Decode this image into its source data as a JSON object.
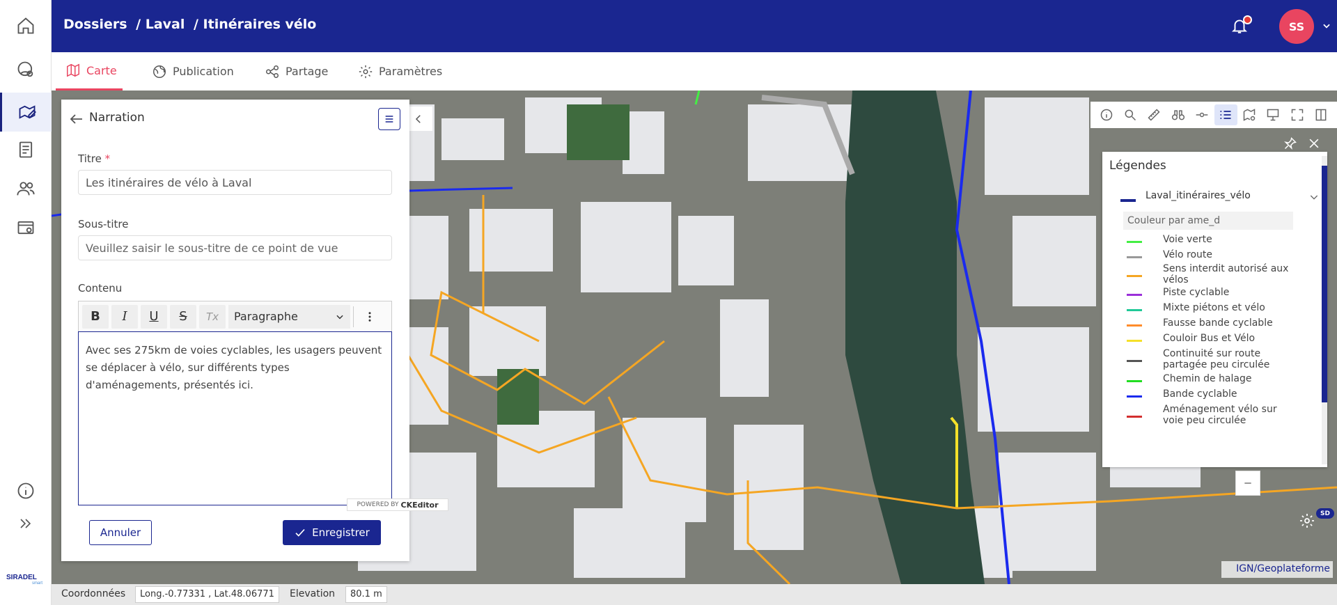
{
  "breadcrumb": {
    "items": [
      "Dossiers",
      "/ Laval",
      "/ Itinéraires vélo"
    ]
  },
  "user": {
    "initials": "SS"
  },
  "tabs": [
    {
      "label": "Carte"
    },
    {
      "label": "Publication"
    },
    {
      "label": "Partage"
    },
    {
      "label": "Paramètres"
    }
  ],
  "panel": {
    "title": "Narration",
    "titre_label": "Titre",
    "required_mark": "*",
    "titre_value": "Les itinéraires de vélo à Laval",
    "soustitre_label": "Sous-titre",
    "soustitre_placeholder": "Veuillez saisir le sous-titre de ce point de vue",
    "contenu_label": "Contenu",
    "toolbar": {
      "bold": "B",
      "italic": "I",
      "underline": "U",
      "strike": "S",
      "clear": "Tx",
      "format": "Paragraphe"
    },
    "content_text": "Avec ses 275km de voies cyclables, les usagers peuvent se déplacer à vélo, sur différents types d'aménagements, présentés ici.",
    "powered_by": "POWERED BY",
    "editor_brand": "CKEditor",
    "cancel": "Annuler",
    "save": "Enregistrer"
  },
  "legend": {
    "title": "Légendes",
    "layer": "Laval_itinéraires_vélo",
    "color_by": "Couleur par ame_d",
    "items": [
      {
        "label": "Voie verte",
        "color": "#44ee44"
      },
      {
        "label": "Vélo route",
        "color": "#999999"
      },
      {
        "label": "Sens interdit autorisé aux vélos",
        "color": "#f5a623"
      },
      {
        "label": "Piste cyclable",
        "color": "#9b30d9"
      },
      {
        "label": "Mixte piétons et vélo",
        "color": "#20c997"
      },
      {
        "label": "Fausse bande cyclable",
        "color": "#ff8c2b"
      },
      {
        "label": "Couloir Bus et Vélo",
        "color": "#f5e02a"
      },
      {
        "label": "Continuité sur route partagée peu circulée",
        "color": "#555555"
      },
      {
        "label": "Chemin de halage",
        "color": "#22dd22"
      },
      {
        "label": "Bande cyclable",
        "color": "#1a2aee"
      },
      {
        "label": "Aménagement vélo sur voie peu circulée",
        "color": "#d32f2f"
      }
    ]
  },
  "map": {
    "badge": "SD",
    "attribution": "IGN/Geoplateforme"
  },
  "status": {
    "coords_label": "Coordonnées",
    "coords_value": "Long.-0.77331 , Lat.48.06771",
    "elevation_label": "Elevation",
    "elevation_value": "80.1 m"
  },
  "colors": {
    "brand": "#1a2690",
    "accent": "#e94560"
  }
}
